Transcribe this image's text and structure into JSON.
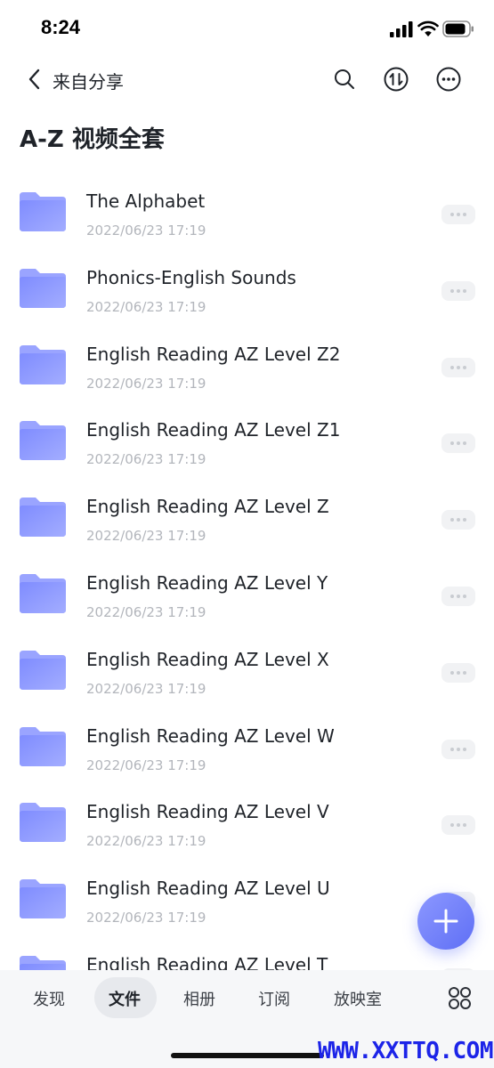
{
  "status_bar": {
    "time": "8:24"
  },
  "nav": {
    "back_label": "来自分享"
  },
  "page_title": "A-Z 视频全套",
  "files": [
    {
      "name": "The Alphabet",
      "date": "2022/06/23 17:19"
    },
    {
      "name": "Phonics-English Sounds",
      "date": "2022/06/23 17:19"
    },
    {
      "name": "English Reading AZ Level Z2",
      "date": "2022/06/23 17:19"
    },
    {
      "name": "English Reading AZ Level Z1",
      "date": "2022/06/23 17:19"
    },
    {
      "name": "English Reading AZ Level Z",
      "date": "2022/06/23 17:19"
    },
    {
      "name": "English Reading AZ Level Y",
      "date": "2022/06/23 17:19"
    },
    {
      "name": "English Reading AZ Level X",
      "date": "2022/06/23 17:19"
    },
    {
      "name": "English Reading AZ Level W",
      "date": "2022/06/23 17:19"
    },
    {
      "name": "English Reading AZ Level V",
      "date": "2022/06/23 17:19"
    },
    {
      "name": "English Reading AZ Level U",
      "date": "2022/06/23 17:19"
    },
    {
      "name": "English Reading AZ Level T",
      "date": ""
    }
  ],
  "tabs": [
    {
      "label": "发现"
    },
    {
      "label": "文件"
    },
    {
      "label": "相册"
    },
    {
      "label": "订阅"
    },
    {
      "label": "放映室"
    }
  ],
  "active_tab": "文件",
  "watermark": "WWW.XXTTQ.COM",
  "colors": {
    "accent": "#6675f7",
    "folder": "#8e9bff"
  }
}
